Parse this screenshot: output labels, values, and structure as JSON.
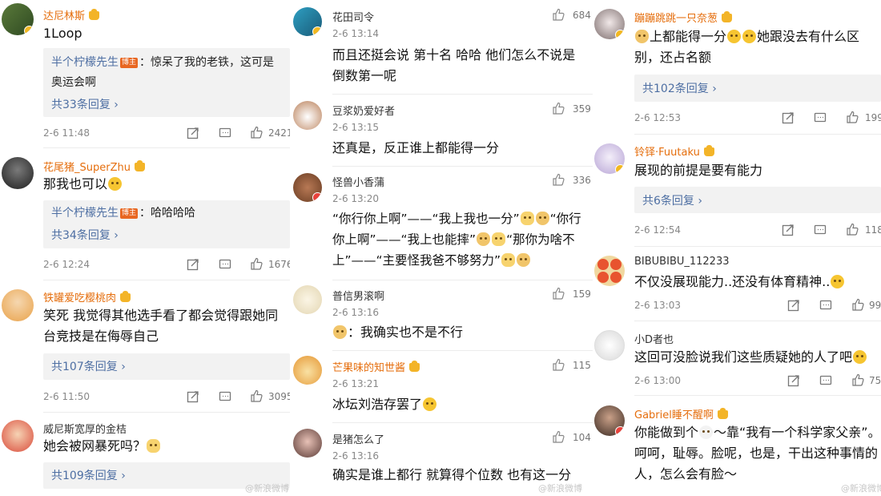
{
  "left": {
    "comments": [
      {
        "name": "达尼林斯",
        "name_color": "orange",
        "text": "1Loop",
        "reply": {
          "user": "半个柠檬先生",
          "badge": "博主",
          "text": "：惊呆了我的老铁，这可是奥运会啊"
        },
        "reply_count": "共33条回复",
        "time": "2-6 11:48",
        "likes": "2421"
      },
      {
        "name": "花尾猪_SuperZhu",
        "name_color": "orange",
        "text": "那我也可以",
        "reply": {
          "user": "半个柠檬先生",
          "badge": "博主",
          "text": "：哈哈哈哈"
        },
        "reply_count": "共34条回复",
        "time": "2-6 12:24",
        "likes": "1676"
      },
      {
        "name": "铁罐爱吃樱桃肉",
        "name_color": "orange",
        "text": "笑死 我觉得其他选手看了都会觉得跟她同台竞技是在侮辱自己",
        "reply_count": "共107条回复",
        "time": "2-6 11:50",
        "likes": "3095"
      },
      {
        "name": "威尼斯宽厚的金桔",
        "name_color": "gray",
        "text": "她会被网暴死吗？",
        "reply_count": "共109条回复"
      }
    ],
    "watermark": "@新浪微博"
  },
  "middle": {
    "comments": [
      {
        "name": "花田司令",
        "time": "2-6 13:14",
        "likes": "684",
        "text": "而且还挺会说 第十名 哈哈 他们怎么不说是倒数第一呢"
      },
      {
        "name": "豆浆奶爱好者",
        "time": "2-6 13:15",
        "likes": "359",
        "text": "还真是，反正谁上都能得一分"
      },
      {
        "name": "怪兽小香蒲",
        "time": "2-6 13:20",
        "likes": "336",
        "text_lines": [
          "“你行你上啊”——“我上我也一分”",
          "“你行",
          "你上啊”——“我上也能摔”",
          "“那你为啥不",
          "上”——“主要怪我爸不够努力”"
        ]
      },
      {
        "name": "普信男滚啊",
        "time": "2-6 13:16",
        "likes": "159",
        "text": "：我确实也不是不行"
      },
      {
        "name": "芒果味的知世酱",
        "time": "2-6 13:21",
        "likes": "115",
        "text": "冰坛刘浩存罢了"
      },
      {
        "name": "是猪怎么了",
        "time": "2-6 13:16",
        "likes": "104",
        "text": "确实是谁上都行 就算得个位数 也有这一分"
      }
    ],
    "watermark": "@新浪微博"
  },
  "right": {
    "comments": [
      {
        "name": "蹦蹦跳跳一只奈葱",
        "text": "上都能得一分",
        "text2": "她跟没去有什么区别，还占名额",
        "reply_count": "共102条回复",
        "time": "2-6 12:53",
        "likes": "199"
      },
      {
        "name": "铃铎·Fuutaku",
        "text": "展现的前提是要有能力",
        "reply_count": "共6条回复",
        "time": "2-6 12:54",
        "likes": "118"
      },
      {
        "name": "BIBUBIBU_112233",
        "text": "不仅没展现能力..还没有体育精神..",
        "time": "2-6 13:03",
        "likes": "99"
      },
      {
        "name": "小D者也",
        "text": "这回可没脸说我们这些质疑她的人了吧",
        "time": "2-6 13:00",
        "likes": "75"
      },
      {
        "name": "Gabriel睡不醒啊",
        "text": "你能做到个",
        "text2": "～靠“我有一个科学家父亲”。呵呵，耻辱。脸呢，也是，干出这种事情的人，怎么会有脸～"
      }
    ],
    "watermark": "@新浪微博"
  },
  "colors": {
    "orange_name": "#e56e0d",
    "reply_link": "#4e6fa3",
    "time": "#888888",
    "reply_bg": "#f2f2f2"
  },
  "icons": [
    "verified-badge-icon",
    "crown-icon",
    "share-icon",
    "comment-icon",
    "like-icon",
    "chevron-right-icon"
  ]
}
